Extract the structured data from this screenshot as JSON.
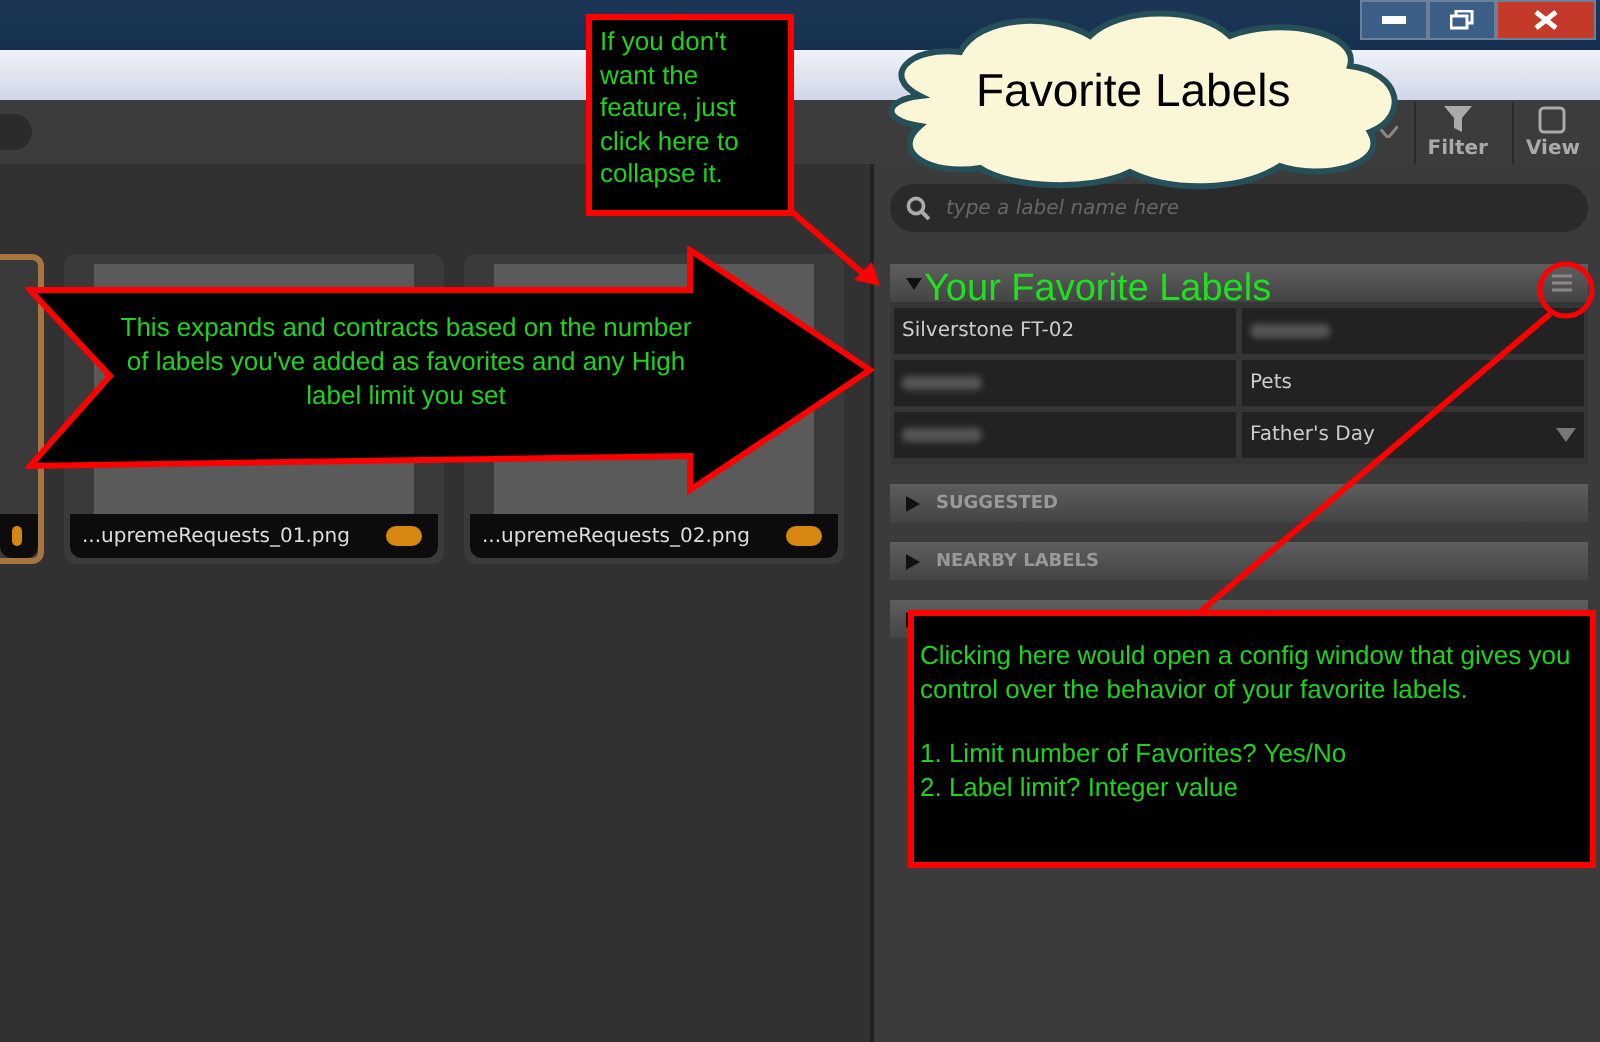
{
  "window_controls": [
    {
      "kind": "minimize"
    },
    {
      "kind": "restore"
    },
    {
      "kind": "close"
    }
  ],
  "toolbar": {
    "buttons": [
      {
        "label": "Filter",
        "kind": "filter"
      },
      {
        "label": "View",
        "kind": "view"
      }
    ]
  },
  "thumbnails": [
    {
      "selected": true
    },
    {
      "caption": "...upremeRequests_01.png",
      "selected": false
    },
    {
      "caption": "...upremeRequests_02.png",
      "selected": false
    }
  ],
  "label_panel": {
    "search": {
      "placeholder": "type a label name here"
    },
    "favorites": {
      "expanded": true,
      "cells": [
        {
          "kind": "text",
          "label": "Silverstone FT-02"
        },
        {
          "kind": "blurred"
        },
        {
          "kind": "blurred"
        },
        {
          "kind": "text",
          "label": "Pets"
        },
        {
          "kind": "blurred"
        },
        {
          "kind": "dropdown",
          "label": "Father's Day"
        }
      ]
    },
    "sections": [
      {
        "title": "SUGGESTED",
        "expanded": false
      },
      {
        "title": "NEARBY LABELS",
        "expanded": false
      },
      {
        "expanded": false
      }
    ]
  },
  "annotations": {
    "collapse_note": "If you don't want the feature, just click here to collapse it.",
    "cloud_title": "Favorite Labels",
    "arrow_note": "This expands and contracts based on the number of labels you've added as favorites and any High label limit you set",
    "section_title": "Your Favorite Labels",
    "config_note": [
      "Clicking here would open a config window that gives you control over the behavior of your favorite labels.",
      "1. Limit number of Favorites? Yes/No",
      "2. Label limit? Integer value"
    ]
  }
}
